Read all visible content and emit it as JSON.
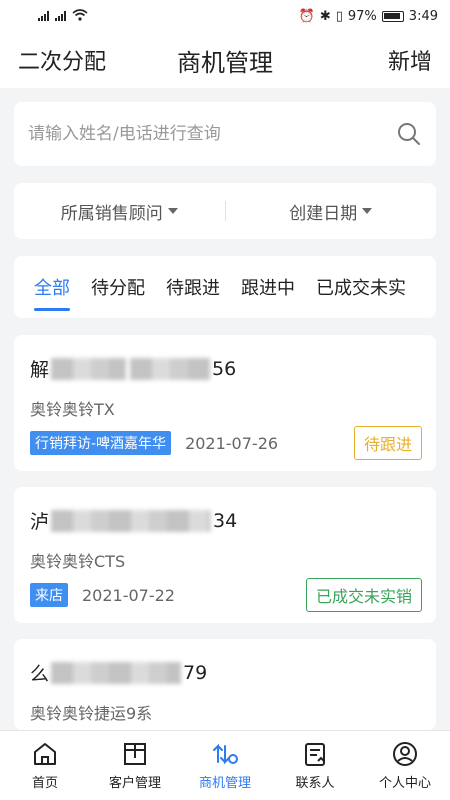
{
  "status_bar": {
    "battery": "97%",
    "time": "3:49"
  },
  "header": {
    "left": "二次分配",
    "title": "商机管理",
    "right": "新增"
  },
  "search": {
    "placeholder": "请输入姓名/电话进行查询"
  },
  "filters": [
    {
      "label": "所属销售顾问"
    },
    {
      "label": "创建日期"
    }
  ],
  "tabs": [
    {
      "label": "全部"
    },
    {
      "label": "待分配"
    },
    {
      "label": "待跟进"
    },
    {
      "label": "跟进中"
    },
    {
      "label": "已成交未实"
    }
  ],
  "cards": [
    {
      "name_head": "解",
      "name_tail": "56",
      "company": "奥铃奥铃TX",
      "source": "行销拜访-啤酒嘉年华",
      "date": "2021-07-26",
      "status": "待跟进"
    },
    {
      "name_head": "泸",
      "name_tail": "34",
      "company": "奥铃奥铃CTS",
      "source": "来店",
      "date": "2021-07-22",
      "status": "已成交未实销"
    },
    {
      "name_head": "么",
      "name_tail": "79",
      "company": "奥铃奥铃捷运9系"
    }
  ],
  "bottom_nav": [
    {
      "label": "首页",
      "icon": "home-icon"
    },
    {
      "label": "客户管理",
      "icon": "customer-icon"
    },
    {
      "label": "商机管理",
      "icon": "opportunity-icon"
    },
    {
      "label": "联系人",
      "icon": "contact-icon"
    },
    {
      "label": "个人中心",
      "icon": "profile-icon"
    }
  ],
  "colors": {
    "accent": "#2d7bf2",
    "tag": "#3f8ef0",
    "pending": "#e5b12d",
    "done": "#3aa35a"
  }
}
